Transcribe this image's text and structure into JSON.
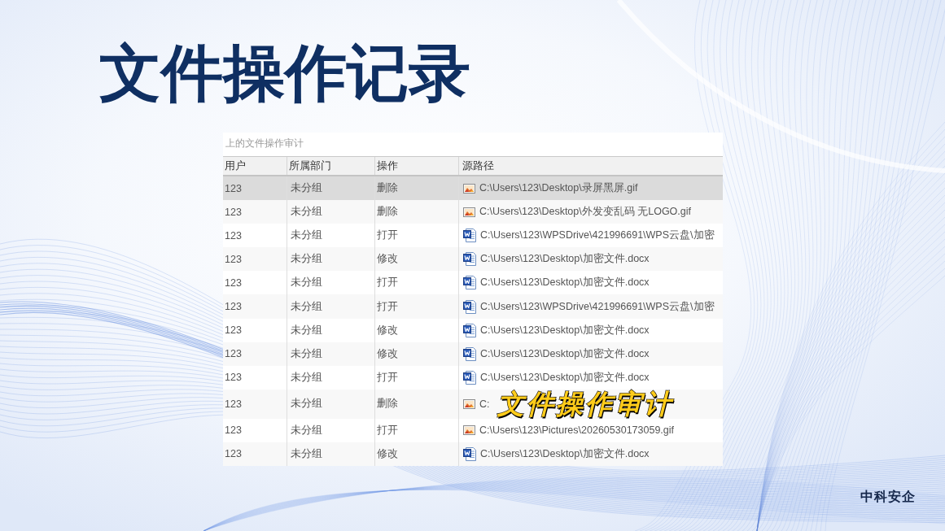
{
  "slide": {
    "title": "文件操作记录"
  },
  "window": {
    "title": "上的文件操作审计"
  },
  "table": {
    "columns": [
      "用户",
      "所属部门",
      "操作",
      "源路径"
    ],
    "rows": [
      {
        "user": "123",
        "department": "未分组",
        "action": "删除",
        "kind": "image",
        "path": "C:\\Users\\123\\Desktop\\录屏黑屏.gif",
        "selected": true
      },
      {
        "user": "123",
        "department": "未分组",
        "action": "删除",
        "kind": "image",
        "path": "C:\\Users\\123\\Desktop\\外发变乱码 无LOGO.gif",
        "selected": false
      },
      {
        "user": "123",
        "department": "未分组",
        "action": "打开",
        "kind": "document",
        "path": "C:\\Users\\123\\WPSDrive\\421996691\\WPS云盘\\加密",
        "selected": false
      },
      {
        "user": "123",
        "department": "未分组",
        "action": "修改",
        "kind": "document",
        "path": "C:\\Users\\123\\Desktop\\加密文件.docx",
        "selected": false
      },
      {
        "user": "123",
        "department": "未分组",
        "action": "打开",
        "kind": "document",
        "path": "C:\\Users\\123\\Desktop\\加密文件.docx",
        "selected": false
      },
      {
        "user": "123",
        "department": "未分组",
        "action": "打开",
        "kind": "document",
        "path": "C:\\Users\\123\\WPSDrive\\421996691\\WPS云盘\\加密",
        "selected": false
      },
      {
        "user": "123",
        "department": "未分组",
        "action": "修改",
        "kind": "document",
        "path": "C:\\Users\\123\\Desktop\\加密文件.docx",
        "selected": false
      },
      {
        "user": "123",
        "department": "未分组",
        "action": "修改",
        "kind": "document",
        "path": "C:\\Users\\123\\Desktop\\加密文件.docx",
        "selected": false
      },
      {
        "user": "123",
        "department": "未分组",
        "action": "打开",
        "kind": "document",
        "path": "C:\\Users\\123\\Desktop\\加密文件.docx",
        "selected": false
      },
      {
        "user": "123",
        "department": "未分组",
        "action": "删除",
        "kind": "image",
        "path": "C:",
        "overlay_caption": "文件操作审计",
        "selected": false
      },
      {
        "user": "123",
        "department": "未分组",
        "action": "打开",
        "kind": "image",
        "path": "C:\\Users\\123\\Pictures\\20260530173059.gif",
        "selected": false
      },
      {
        "user": "123",
        "department": "未分组",
        "action": "修改",
        "kind": "document",
        "path": "C:\\Users\\123\\Desktop\\加密文件.docx",
        "selected": false
      }
    ]
  },
  "footer": {
    "brand": "中科安企"
  }
}
